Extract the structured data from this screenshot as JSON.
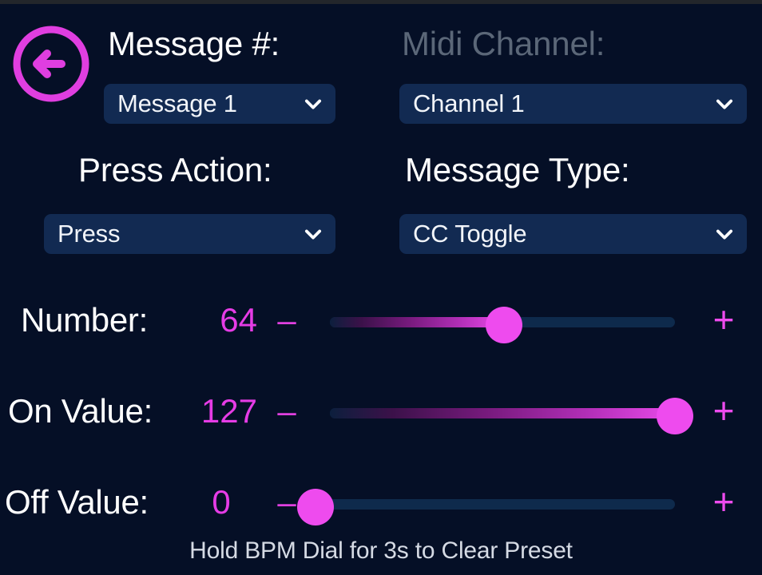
{
  "theme": {
    "background": "#050f26",
    "accent_magenta": "#ee4bee",
    "value_magenta": "#e63ce6",
    "dropdown_bg": "#122a52",
    "text_primary": "#ffffff",
    "text_muted": "#5b6778",
    "track_empty": "#0e2a4c"
  },
  "header": {
    "back_icon": "arrow-left-circle-icon"
  },
  "selectors": [
    {
      "label": "Message #:",
      "label_state": "active",
      "value": "Message 1",
      "caret_icon": "chevron-down-icon"
    },
    {
      "label": "Midi Channel:",
      "label_state": "muted",
      "value": "Channel 1",
      "caret_icon": "chevron-down-icon"
    },
    {
      "label": "Press Action:",
      "label_state": "active",
      "value": "Press",
      "caret_icon": "chevron-down-icon"
    },
    {
      "label": "Message Type:",
      "label_state": "active",
      "value": "CC Toggle",
      "caret_icon": "chevron-down-icon"
    }
  ],
  "sliders": [
    {
      "label": "Number:",
      "value": "64",
      "value_number": 64,
      "min": 0,
      "max": 127,
      "minus_label": "–",
      "plus_label": "+"
    },
    {
      "label": "On Value:",
      "value": "127",
      "value_number": 127,
      "min": 0,
      "max": 127,
      "minus_label": "–",
      "plus_label": "+"
    },
    {
      "label": "Off Value:",
      "value": "0",
      "value_number": 0,
      "min": 0,
      "max": 127,
      "minus_label": "–",
      "plus_label": "+"
    }
  ],
  "footer": {
    "hint": "Hold BPM Dial for 3s to Clear Preset"
  }
}
